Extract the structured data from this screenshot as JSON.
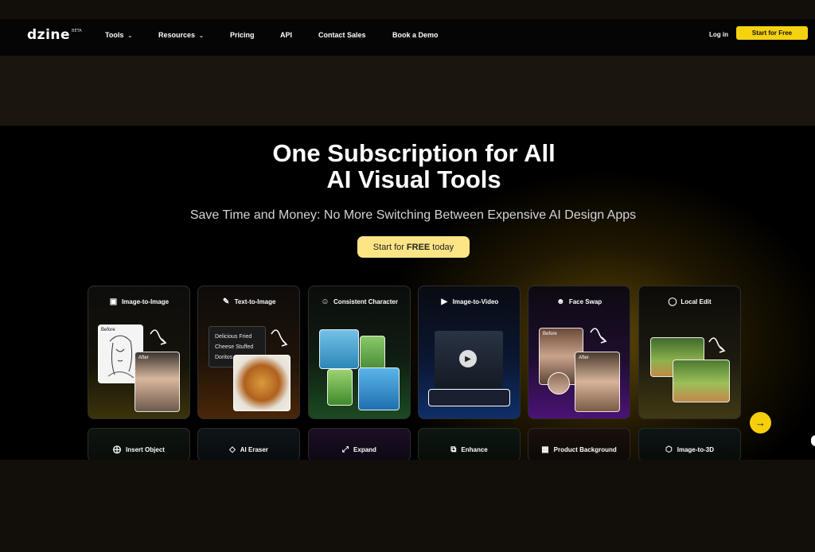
{
  "nav": {
    "logo": "dzine",
    "logo_badge": "BETA",
    "items": [
      {
        "label": "Tools",
        "dropdown": true
      },
      {
        "label": "Resources",
        "dropdown": true
      },
      {
        "label": "Pricing",
        "dropdown": false
      },
      {
        "label": "API",
        "dropdown": false
      },
      {
        "label": "Contact Sales",
        "dropdown": false
      },
      {
        "label": "Book a Demo",
        "dropdown": false
      }
    ],
    "login": "Log in",
    "start": "Start for Free"
  },
  "hero": {
    "title_line1": "One Subscription for All",
    "title_line2": "AI Visual Tools",
    "subtitle": "Save Time and Money: No More Switching Between Expensive AI Design Apps",
    "cta_prefix": "Start for",
    "cta_bold": "FREE",
    "cta_suffix": "today"
  },
  "cards": [
    {
      "label": "Image-to-Image",
      "icon": "image-icon",
      "before": "Before",
      "after": "After"
    },
    {
      "label": "Text-to-Image",
      "icon": "text-icon",
      "prompt_lines": [
        "Delicious Fried",
        "Cheese Stuffed",
        "Doritos"
      ]
    },
    {
      "label": "Consistent Character",
      "icon": "character-icon"
    },
    {
      "label": "Image-to-Video",
      "icon": "video-icon"
    },
    {
      "label": "Face Swap",
      "icon": "face-icon",
      "before": "Before",
      "after": "After"
    },
    {
      "label": "Local Edit",
      "icon": "local-edit-icon"
    }
  ],
  "tools_row2": [
    {
      "label": "Insert Object",
      "icon": "insert-object-icon"
    },
    {
      "label": "AI Eraser",
      "icon": "eraser-icon"
    },
    {
      "label": "Expand",
      "icon": "expand-icon"
    },
    {
      "label": "Enhance",
      "icon": "enhance-icon"
    },
    {
      "label": "Product Background",
      "icon": "product-background-icon"
    },
    {
      "label": "Image-to-3D",
      "icon": "cube-icon"
    }
  ],
  "colors": {
    "accent": "#f5d20f",
    "cta_bg": "#fde586"
  }
}
